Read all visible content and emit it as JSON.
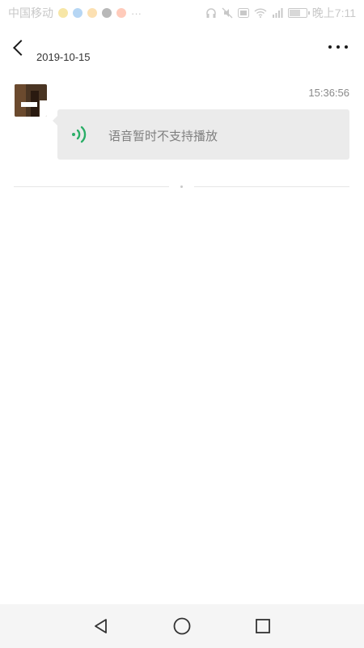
{
  "status_bar": {
    "carrier": "中国移动",
    "time": "晚上7:11",
    "more_indicator": "···",
    "icons": [
      "headphones-icon",
      "mute-icon",
      "hd-icon",
      "wifi-icon",
      "signal-icon",
      "battery-icon"
    ]
  },
  "header": {
    "date": "2019-10-15",
    "back_icon": "chevron-left-icon",
    "more_icon": "more-dots-icon"
  },
  "message": {
    "time": "15:36:56",
    "voice_text": "语音暂时不支持播放",
    "voice_icon": "voice-wave-icon",
    "voice_icon_color": "#2aae67",
    "bubble_color": "#ebebeb"
  },
  "nav_bar": {
    "icons": [
      "nav-back-icon",
      "nav-home-icon",
      "nav-recents-icon"
    ]
  }
}
